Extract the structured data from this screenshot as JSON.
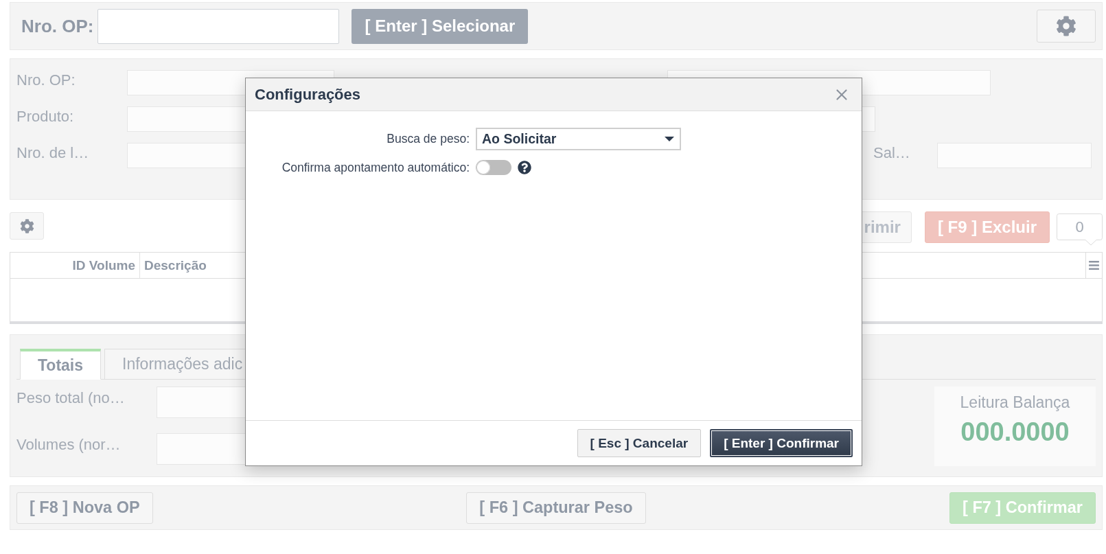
{
  "search_bar": {
    "label": "Nro. OP:",
    "button": "[ Enter ] Selecionar"
  },
  "details": {
    "rows": [
      [
        {
          "kind": "label",
          "text": "Nro. OP:"
        },
        {
          "kind": "input"
        },
        {
          "kind": "input"
        }
      ],
      [
        {
          "kind": "label",
          "text": "Produto:"
        },
        {
          "kind": "input"
        }
      ],
      [
        {
          "kind": "label",
          "text": "Nro. de l…"
        },
        {
          "kind": "input"
        },
        {
          "kind": "label",
          "text": "Sal…"
        },
        {
          "kind": "input"
        }
      ]
    ]
  },
  "toolbar": {
    "buttons": [
      {
        "kind": "default",
        "label": "rimir"
      },
      {
        "kind": "danger",
        "label": "[ F9 ] Excluir"
      }
    ],
    "count": "0"
  },
  "table": {
    "columns": [
      "ID Volume",
      "Descrição"
    ]
  },
  "totals": {
    "tabs": [
      {
        "label": "Totais",
        "selected": true
      },
      {
        "label": "Informações adic",
        "selected": false
      }
    ],
    "fields": [
      {
        "label": "Peso total (no…"
      },
      {
        "label": "Volumes (nor…"
      }
    ],
    "scale_reading": {
      "label": "Leitura Balança",
      "value": "000.0000"
    }
  },
  "actions": [
    {
      "kind": "default",
      "label": "[ F8 ] Nova OP"
    },
    {
      "kind": "default",
      "label": "[ F6 ] Capturar Peso"
    },
    {
      "kind": "success",
      "label": "[ F7 ] Confirmar"
    }
  ],
  "dialog": {
    "title": "Configurações",
    "settings": [
      {
        "kind": "select",
        "label": "Busca de peso:",
        "value": "Ao Solicitar"
      },
      {
        "kind": "toggle",
        "label": "Confirma apontamento automático:",
        "on": false,
        "help": true
      }
    ],
    "buttons": [
      {
        "kind": "secondary",
        "label": "[ Esc ] Cancelar"
      },
      {
        "kind": "primary",
        "label": "[ Enter ] Confirmar"
      }
    ]
  }
}
